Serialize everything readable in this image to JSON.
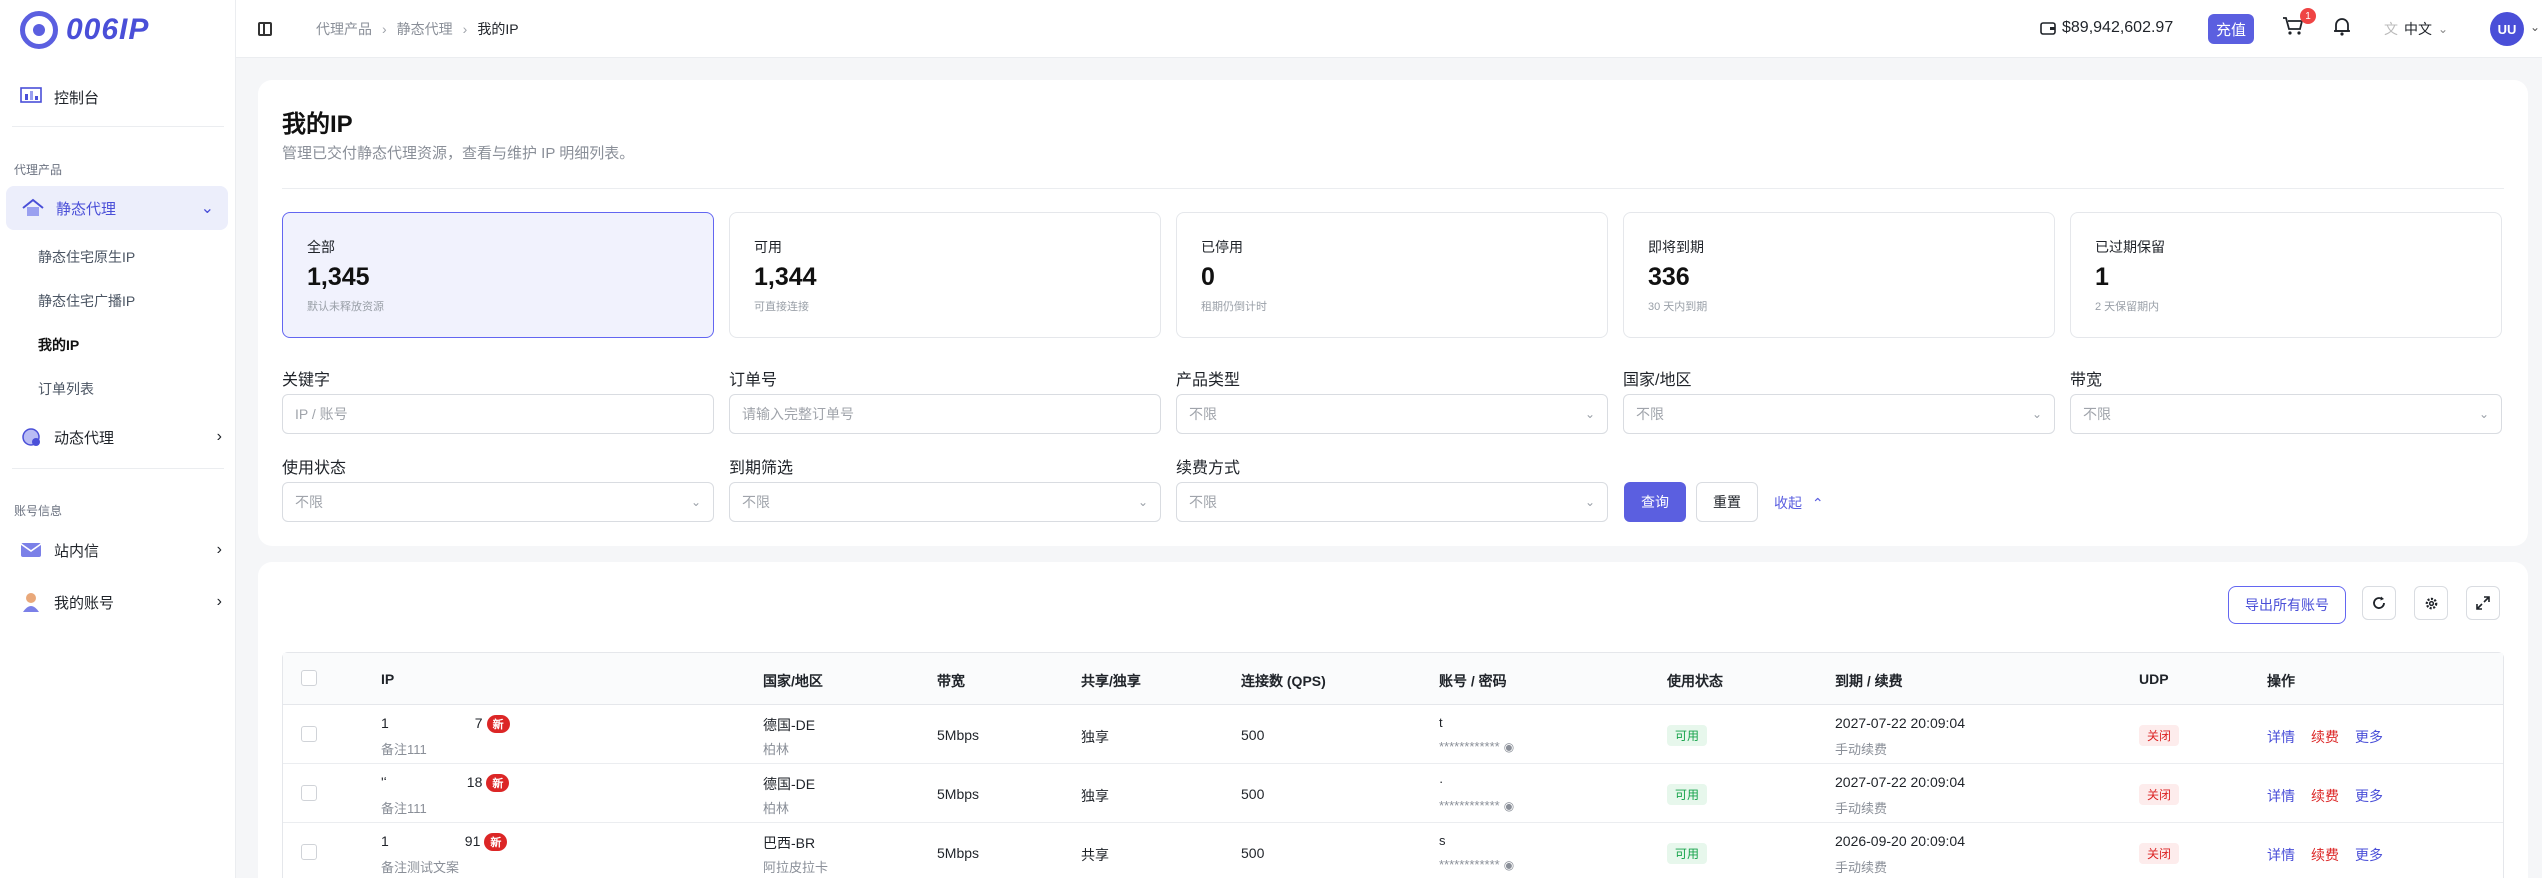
{
  "brand": {
    "name": "006IP"
  },
  "sidebar": {
    "dashboard": "控制台",
    "section_proxy": "代理产品",
    "static_proxy": "静态代理",
    "static_items": [
      "静态住宅原生IP",
      "静态住宅广播IP",
      "我的IP",
      "订单列表"
    ],
    "dynamic_proxy": "动态代理",
    "section_account": "账号信息",
    "messages": "站内信",
    "my_account": "我的账号"
  },
  "topbar": {
    "breadcrumbs": [
      "代理产品",
      "静态代理",
      "我的IP"
    ],
    "balance": "$89,942,602.97",
    "recharge": "充值",
    "cart_count": "1",
    "language": "中文",
    "avatar": "UU"
  },
  "page": {
    "title": "我的IP",
    "subtitle": "管理已交付静态代理资源，查看与维护 IP 明细列表。"
  },
  "stats": [
    {
      "label": "全部",
      "value": "1,345",
      "hint": "默认未释放资源"
    },
    {
      "label": "可用",
      "value": "1,344",
      "hint": "可直接连接"
    },
    {
      "label": "已停用",
      "value": "0",
      "hint": "租期仍倒计时"
    },
    {
      "label": "即将到期",
      "value": "336",
      "hint": "30 天内到期"
    },
    {
      "label": "已过期保留",
      "value": "1",
      "hint": "2 天保留期内"
    }
  ],
  "filters": {
    "keyword_label": "关键字",
    "keyword_placeholder": "IP / 账号",
    "order_label": "订单号",
    "order_placeholder": "请输入完整订单号",
    "product_label": "产品类型",
    "product_value": "不限",
    "country_label": "国家/地区",
    "country_value": "不限",
    "bandwidth_label": "带宽",
    "bandwidth_value": "不限",
    "status_label": "使用状态",
    "status_value": "不限",
    "expiry_label": "到期筛选",
    "expiry_value": "不限",
    "renew_label": "续费方式",
    "renew_value": "不限",
    "query": "查询",
    "reset": "重置",
    "collapse": "收起"
  },
  "toolbar": {
    "export": "导出所有账号"
  },
  "table": {
    "headers": [
      "IP",
      "国家/地区",
      "带宽",
      "共享/独享",
      "连接数 (QPS)",
      "账号 / 密码",
      "使用状态",
      "到期 / 续费",
      "UDP",
      "操作"
    ],
    "new_label": "新",
    "actions": [
      "详情",
      "续费",
      "更多"
    ],
    "rows": [
      {
        "ip_a": "1",
        "ip_b": "7",
        "note": "备注111",
        "country": "德国-DE",
        "city": "柏林",
        "bandwidth": "5Mbps",
        "share": "独享",
        "qps": "500",
        "account": "t",
        "password": "************",
        "status": "可用",
        "expiry": "2027-07-22 20:09:04",
        "renew": "手动续费",
        "udp": "关闭"
      },
      {
        "ip_a": "'ʻ",
        "ip_b": "18",
        "note": "备注111",
        "country": "德国-DE",
        "city": "柏林",
        "bandwidth": "5Mbps",
        "share": "独享",
        "qps": "500",
        "account": "·",
        "password": "************",
        "status": "可用",
        "expiry": "2027-07-22 20:09:04",
        "renew": "手动续费",
        "udp": "关闭"
      },
      {
        "ip_a": "1",
        "ip_b": "91",
        "note": "备注测试文案",
        "country": "巴西-BR",
        "city": "阿拉皮拉卡",
        "bandwidth": "5Mbps",
        "share": "共享",
        "qps": "500",
        "account": "s",
        "password": "************",
        "status": "可用",
        "expiry": "2026-09-20 20:09:04",
        "renew": "手动续费",
        "udp": "关闭"
      }
    ]
  }
}
